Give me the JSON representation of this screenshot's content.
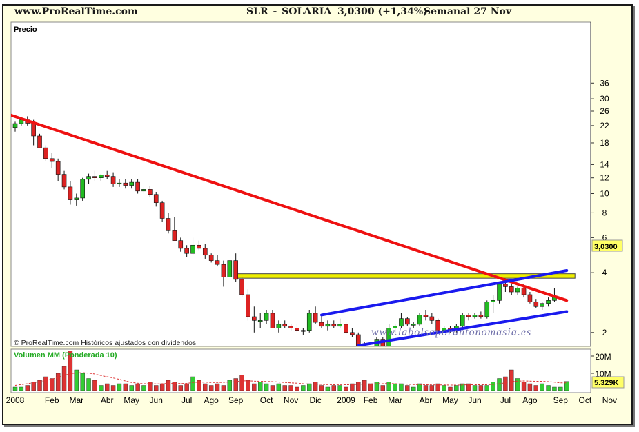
{
  "header": {
    "site": "www.ProRealTime.com",
    "symbol": "SLR - SOLARIA",
    "price_change": "3,0300 (+1,34%)",
    "period": "Semanal  27 Nov"
  },
  "colors": {
    "up": "#22bb22",
    "down": "#dd2222",
    "trend_down": "#ee1111",
    "channel": "#1a1aee",
    "resistance": "#eeee00",
    "volume_up": "#33cc33",
    "volume_down": "#dd3333",
    "volume_ma": "#dd3333",
    "background": "#ffffe0"
  },
  "chart_data": [
    {
      "type": "candlestick",
      "title": "Precio",
      "yscale": "log",
      "ylim": [
        1.3,
        40
      ],
      "y_ticks": [
        36,
        30,
        26,
        22,
        18,
        14,
        12,
        10,
        8,
        6,
        4,
        2
      ],
      "last_value_label": "3,0300",
      "footer": "© ProRealTime.com  Históricos ajustados con dividendos",
      "watermark": "www.labolsaporantonomasia.es",
      "x_labels": [
        "2008",
        "Feb",
        "Mar",
        "Abr",
        "May",
        "Jun",
        "Jul",
        "Ago",
        "Sep",
        "Oct",
        "Nov",
        "Dic",
        "2009",
        "Feb",
        "Mar",
        "Abr",
        "May",
        "Jun",
        "Jul",
        "Ago",
        "Sep",
        "Oct",
        "Nov"
      ],
      "x_label_weeks": [
        0,
        6,
        10,
        15,
        19,
        23,
        28,
        32,
        36,
        41,
        45,
        49,
        54,
        58,
        62,
        67,
        71,
        75,
        80,
        84,
        89,
        93,
        97
      ],
      "candles": [
        [
          21.5,
          23,
          20.5,
          22.5
        ],
        [
          22.5,
          24,
          22,
          23.5
        ],
        [
          23.5,
          24.5,
          22,
          22.6
        ],
        [
          22.6,
          23.5,
          17.5,
          19.5
        ],
        [
          19.5,
          20,
          17,
          17
        ],
        [
          17,
          17.5,
          14.5,
          15
        ],
        [
          15,
          16,
          13.5,
          14.5
        ],
        [
          14.5,
          15,
          11.5,
          12.5
        ],
        [
          12.5,
          13,
          10.5,
          10.8
        ],
        [
          10.8,
          11.5,
          8.8,
          9.3
        ],
        [
          9.3,
          10,
          8.7,
          9.5
        ],
        [
          9.5,
          12,
          9.2,
          11.8
        ],
        [
          11.8,
          12.6,
          11.2,
          12.2
        ],
        [
          12.2,
          13,
          11.5,
          12
        ],
        [
          12,
          12.5,
          11.6,
          12.4
        ],
        [
          12.4,
          13,
          11.8,
          12.2
        ],
        [
          12.2,
          12.8,
          10.8,
          11.2
        ],
        [
          11.2,
          11.8,
          10.8,
          11.3
        ],
        [
          11.3,
          11.8,
          10.6,
          11
        ],
        [
          11,
          11.8,
          10.6,
          11.4
        ],
        [
          11.4,
          11.8,
          10,
          10.3
        ],
        [
          10.3,
          10.8,
          10,
          10.5
        ],
        [
          10.5,
          10.9,
          9.6,
          9.9
        ],
        [
          9.9,
          10.2,
          8.6,
          9
        ],
        [
          9,
          9.2,
          7.2,
          7.5
        ],
        [
          7.5,
          8,
          6.3,
          6.5
        ],
        [
          6.5,
          7.6,
          6.1,
          5.8
        ],
        [
          5.8,
          6,
          5.1,
          5.3
        ],
        [
          5.3,
          5.5,
          4.8,
          5
        ],
        [
          5,
          6,
          4.9,
          5.5
        ],
        [
          5.5,
          5.8,
          5.2,
          5.3
        ],
        [
          5.3,
          5.6,
          4.7,
          4.9
        ],
        [
          4.9,
          5,
          4.5,
          4.6
        ],
        [
          4.6,
          4.9,
          4.3,
          4.4
        ],
        [
          4.4,
          4.6,
          3.4,
          3.8
        ],
        [
          3.8,
          4.6,
          3.8,
          4.6
        ],
        [
          4.6,
          5,
          3.6,
          3.7
        ],
        [
          3.7,
          3.8,
          3,
          3.1
        ],
        [
          3.1,
          3.3,
          2.3,
          2.4
        ],
        [
          2.4,
          2.7,
          2,
          2.3
        ],
        [
          2.3,
          2.5,
          2.1,
          2.3
        ],
        [
          2.3,
          2.6,
          2.2,
          2.5
        ],
        [
          2.5,
          2.6,
          2.1,
          2.1
        ],
        [
          2.1,
          2.3,
          2,
          2.2
        ],
        [
          2.2,
          2.3,
          2.1,
          2.15
        ],
        [
          2.15,
          2.2,
          2.05,
          2.1
        ],
        [
          2.1,
          2.2,
          2,
          2.05
        ],
        [
          2.05,
          2.1,
          1.95,
          2.05
        ],
        [
          2.05,
          2.6,
          2,
          2.5
        ],
        [
          2.5,
          2.7,
          2.2,
          2.25
        ],
        [
          2.25,
          2.45,
          2.1,
          2.15
        ],
        [
          2.15,
          2.3,
          2.05,
          2.2
        ],
        [
          2.2,
          2.3,
          2.1,
          2.15
        ],
        [
          2.15,
          2.35,
          2.1,
          2.2
        ],
        [
          2.2,
          2.25,
          1.95,
          2.0
        ],
        [
          2.0,
          2.1,
          1.9,
          1.95
        ],
        [
          1.95,
          2.0,
          1.6,
          1.65
        ],
        [
          1.65,
          1.8,
          1.5,
          1.55
        ],
        [
          1.55,
          1.7,
          1.45,
          1.45
        ],
        [
          1.45,
          1.9,
          1.4,
          1.85
        ],
        [
          1.85,
          1.9,
          1.6,
          1.7
        ],
        [
          1.7,
          2.2,
          1.65,
          2.1
        ],
        [
          2.1,
          2.2,
          1.95,
          2.15
        ],
        [
          2.15,
          2.5,
          2.1,
          2.35
        ],
        [
          2.35,
          2.4,
          2.15,
          2.2
        ],
        [
          2.2,
          2.25,
          2.1,
          2.2
        ],
        [
          2.2,
          2.5,
          2.15,
          2.45
        ],
        [
          2.45,
          2.6,
          2.3,
          2.4
        ],
        [
          2.4,
          2.5,
          2.2,
          2.3
        ],
        [
          2.3,
          2.35,
          2.0,
          2.05
        ],
        [
          2.05,
          2.15,
          2.0,
          2.1
        ],
        [
          2.1,
          2.15,
          2.0,
          2.05
        ],
        [
          2.05,
          2.2,
          2.0,
          2.15
        ],
        [
          2.15,
          2.5,
          2.1,
          2.45
        ],
        [
          2.45,
          2.5,
          2.3,
          2.4
        ],
        [
          2.4,
          2.5,
          2.35,
          2.45
        ],
        [
          2.45,
          2.55,
          2.35,
          2.4
        ],
        [
          2.4,
          2.9,
          2.35,
          2.85
        ],
        [
          2.85,
          3.1,
          2.5,
          2.9
        ],
        [
          2.9,
          3.6,
          2.8,
          3.5
        ],
        [
          3.5,
          3.6,
          3.2,
          3.4
        ],
        [
          3.4,
          3.5,
          3.1,
          3.2
        ],
        [
          3.2,
          3.4,
          3.1,
          3.35
        ],
        [
          3.35,
          3.5,
          3.0,
          3.1
        ],
        [
          3.1,
          3.2,
          2.8,
          2.85
        ],
        [
          2.85,
          2.95,
          2.65,
          2.7
        ],
        [
          2.7,
          2.85,
          2.6,
          2.8
        ],
        [
          2.8,
          3.0,
          2.7,
          2.9
        ],
        [
          2.9,
          3.35,
          2.85,
          3.03
        ]
      ],
      "lines": [
        {
          "name": "trend_down",
          "points": [
            [
              -1,
              25
            ],
            [
              90,
              2.9
            ]
          ]
        },
        {
          "name": "channel_top",
          "points": [
            [
              50,
              2.45
            ],
            [
              90,
              4.1
            ]
          ]
        },
        {
          "name": "channel_bottom",
          "points": [
            [
              56,
              1.72
            ],
            [
              90,
              2.55
            ]
          ]
        },
        {
          "name": "resistance_band",
          "low": 3.75,
          "high": 3.95,
          "from_week": 36,
          "to_week": 90
        }
      ]
    },
    {
      "type": "bar",
      "title": "Volumen MM (Ponderada 10)",
      "ylim": [
        0,
        24
      ],
      "y_ticks": [
        {
          "label": "20M",
          "value": 20
        },
        {
          "label": "10M",
          "value": 10
        }
      ],
      "last_value_label": "5.329K",
      "volumes": [
        2,
        2,
        3,
        5,
        6,
        8,
        7,
        10,
        14,
        23,
        12,
        10,
        7,
        6,
        3,
        4,
        3,
        4,
        4,
        3,
        4,
        3,
        5,
        3,
        4,
        6,
        5,
        3,
        4,
        8,
        6,
        4,
        3,
        4,
        3,
        6,
        7,
        9,
        6,
        4,
        5,
        4,
        3,
        4,
        3,
        3,
        2,
        3,
        4,
        5,
        3,
        2,
        3,
        3,
        2,
        4,
        5,
        6,
        4,
        5,
        3,
        5,
        4,
        4,
        3,
        2,
        4,
        3,
        3,
        4,
        3,
        2,
        3,
        4,
        4,
        3,
        3,
        3,
        5,
        7,
        8,
        12,
        7,
        5,
        4,
        3,
        4,
        3,
        2,
        2,
        5.3
      ],
      "ma": [
        3,
        3.5,
        4,
        4.6,
        5.2,
        5.9,
        6.6,
        7.6,
        8.8,
        9.8,
        10.2,
        10.4,
        10.1,
        9.6,
        8.7,
        8,
        7.3,
        6.5,
        5.6,
        4.7,
        4.3,
        4,
        4,
        3.9,
        4,
        4.2,
        4.2,
        4.1,
        4.2,
        4.7,
        4.9,
        4.9,
        4.7,
        4.7,
        4.8,
        5,
        5.2,
        5.6,
        5.7,
        5.5,
        5.4,
        5.3,
        5.2,
        5,
        4.7,
        4.5,
        4.3,
        4,
        3.8,
        3.8,
        3.6,
        3.5,
        3.4,
        3.5,
        3.4,
        3.5,
        3.6,
        3.8,
        3.9,
        4,
        4,
        4.1,
        4,
        3.8,
        3.7,
        3.5,
        3.5,
        3.4,
        3.3,
        3.3,
        3.3,
        3.2,
        3.2,
        3.3,
        3.4,
        3.4,
        3.4,
        3.4,
        3.6,
        4,
        4.5,
        5.3,
        5.5,
        5.6,
        5.5,
        5.4,
        5.4,
        5.2,
        4.9,
        4.5,
        4.5
      ]
    }
  ]
}
